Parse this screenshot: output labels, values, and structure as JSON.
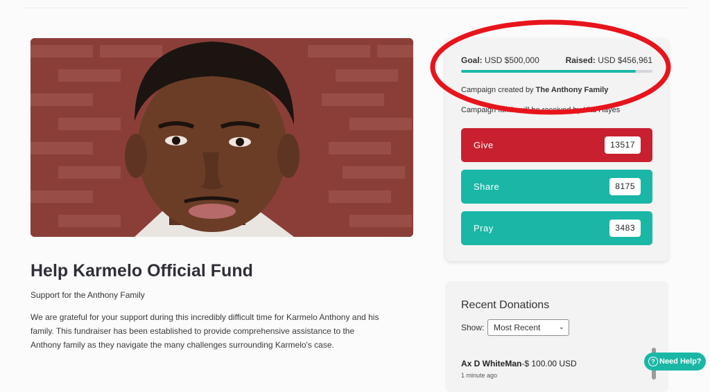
{
  "campaign": {
    "title": "Help Karmelo Official Fund",
    "subtitle": "Support for the Anthony Family",
    "description": "We are grateful for your support during this incredibly difficult time for Karmelo Anthony and his family. This fundraiser has been established to provide comprehensive assistance to the Anthony family as they navigate the many challenges surrounding Karmelo's case.",
    "hero_image": "portrait-photo"
  },
  "funding": {
    "goal_label": "Goal:",
    "goal_value": "USD $500,000",
    "raised_label": "Raised:",
    "raised_value": "USD $456,961",
    "progress_fraction": 0.914,
    "created_prefix": "Campaign created by",
    "created_by": "The Anthony Family",
    "received_line": "Campaign funds will be received by Kita Hayes"
  },
  "actions": {
    "give_label": "Give",
    "give_count": "13517",
    "share_label": "Share",
    "share_count": "8175",
    "pray_label": "Pray",
    "pray_count": "3483"
  },
  "donations": {
    "title": "Recent Donations",
    "show_label": "Show:",
    "sort_selected": "Most Recent",
    "items": [
      {
        "name": "Ax D WhiteMan",
        "amount": "-$ 100.00 USD",
        "time": "1 minute ago"
      }
    ]
  },
  "help": {
    "label": "Need Help?",
    "icon": "question-icon"
  },
  "colors": {
    "give": "#c8202f",
    "teal": "#1ab7a6",
    "annotation": "#e8141c"
  }
}
